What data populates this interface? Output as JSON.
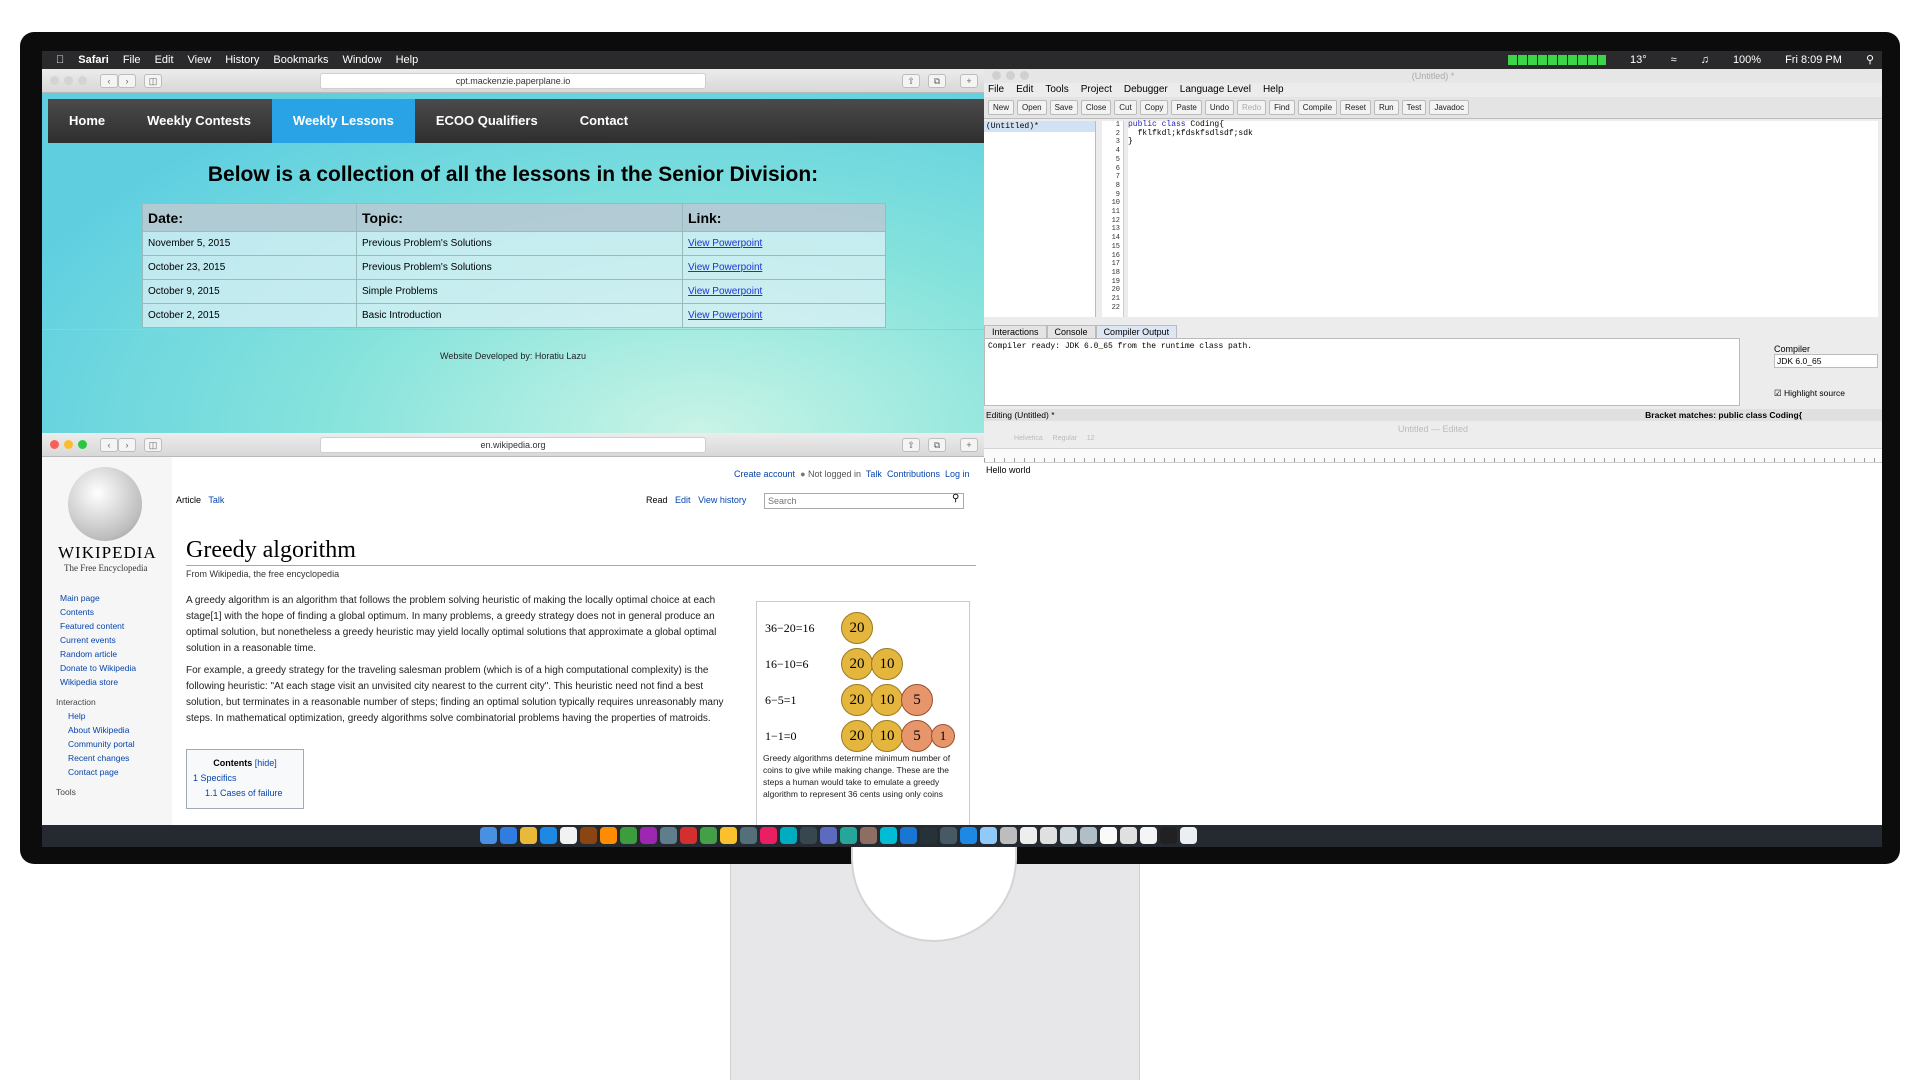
{
  "menubar": {
    "apple": "",
    "items": [
      "Safari",
      "File",
      "Edit",
      "View",
      "History",
      "Bookmarks",
      "Window",
      "Help"
    ],
    "temperature": "13°",
    "battery_pct": "100%",
    "clock": "Fri 8:09 PM"
  },
  "safari_top": {
    "url": "cpt.mackenzie.paperplane.io",
    "nav": [
      "Home",
      "Weekly Contests",
      "Weekly Lessons",
      "ECOO Qualifiers",
      "Contact"
    ],
    "active_nav": "Weekly Lessons",
    "heading": "Below is a collection of all the lessons in the Senior Division:",
    "table": {
      "headers": [
        "Date:",
        "Topic:",
        "Link:"
      ],
      "rows": [
        [
          "November 5, 2015",
          "Previous Problem's Solutions",
          "View Powerpoint"
        ],
        [
          "October 23, 2015",
          "Previous Problem's Solutions",
          "View Powerpoint"
        ],
        [
          "October 9, 2015",
          "Simple Problems",
          "View Powerpoint"
        ],
        [
          "October 2, 2015",
          "Basic Introduction",
          "View Powerpoint"
        ]
      ]
    },
    "credit": "Website Developed by: Horatiu Lazu"
  },
  "safari_bottom": {
    "url": "en.wikipedia.org",
    "top_links": [
      "Create account",
      "Not logged in",
      "Talk",
      "Contributions",
      "Log in"
    ],
    "tabs_left": [
      "Article",
      "Talk"
    ],
    "tabs_right": [
      "Read",
      "Edit",
      "View history"
    ],
    "search_placeholder": "Search",
    "wordmark": "WIKIPEDIA",
    "tagline": "The Free Encyclopedia",
    "sidebar": {
      "main": [
        "Main page",
        "Contents",
        "Featured content",
        "Current events",
        "Random article",
        "Donate to Wikipedia",
        "Wikipedia store"
      ],
      "interaction_header": "Interaction",
      "interaction": [
        "Help",
        "About Wikipedia",
        "Community portal",
        "Recent changes",
        "Contact page"
      ],
      "tools_header": "Tools"
    },
    "title": "Greedy algorithm",
    "subtitle": "From Wikipedia, the free encyclopedia",
    "para1": "A greedy algorithm is an algorithm that follows the problem solving heuristic of making the locally optimal choice at each stage[1] with the hope of finding a global optimum. In many problems, a greedy strategy does not in general produce an optimal solution, but nonetheless a greedy heuristic may yield locally optimal solutions that approximate a global optimal solution in a reasonable time.",
    "para2": "For example, a greedy strategy for the traveling salesman problem (which is of a high computational complexity) is the following heuristic: \"At each stage visit an unvisited city nearest to the current city\". This heuristic need not find a best solution, but terminates in a reasonable number of steps; finding an optimal solution typically requires unreasonably many steps. In mathematical optimization, greedy algorithms solve combinatorial problems having the properties of matroids.",
    "toc": {
      "title": "Contents",
      "hide": "[hide]",
      "items": [
        "1 Specifics",
        "1.1 Cases of failure"
      ]
    },
    "infobox": {
      "rows": [
        {
          "eq": "36−20=16",
          "coins": [
            "20"
          ]
        },
        {
          "eq": "16−10=6",
          "coins": [
            "20",
            "10"
          ]
        },
        {
          "eq": "6−5=1",
          "coins": [
            "20",
            "10",
            "5"
          ]
        },
        {
          "eq": "1−1=0",
          "coins": [
            "20",
            "10",
            "5",
            "1"
          ]
        }
      ],
      "caption": "Greedy algorithms determine minimum number of coins to give while making change. These are the steps a human would take to emulate a greedy algorithm to represent 36 cents using only coins"
    }
  },
  "drjava": {
    "title": "(Untitled) *",
    "menu": [
      "File",
      "Edit",
      "Tools",
      "Project",
      "Debugger",
      "Language Level",
      "Help"
    ],
    "toolbar": [
      "New",
      "Open",
      "Save",
      "Close",
      "Cut",
      "Copy",
      "Paste",
      "Undo",
      "Redo",
      "Find",
      "Compile",
      "Reset",
      "Run",
      "Test",
      "Javadoc"
    ],
    "file_list": [
      "(Untitled)*"
    ],
    "code_lines": [
      "public class Coding{",
      "  fklfkdl;kfdskfsdlsdf;sdk",
      "",
      "}"
    ],
    "line_count": 22,
    "tabs": [
      "Interactions",
      "Console",
      "Compiler Output"
    ],
    "active_tab": "Compiler Output",
    "output": "Compiler ready: JDK 6.0_65 from the runtime class path.",
    "compiler_label": "Compiler",
    "compiler_value": "JDK 6.0_65",
    "highlight_label": "Highlight source",
    "status_left": "Editing (Untitled) *",
    "status_right": "Bracket matches: public class Coding{"
  },
  "textedit": {
    "title": "Untitled — Edited",
    "font": "Helvetica",
    "style": "Regular",
    "size": "12",
    "content": "Hello world"
  }
}
